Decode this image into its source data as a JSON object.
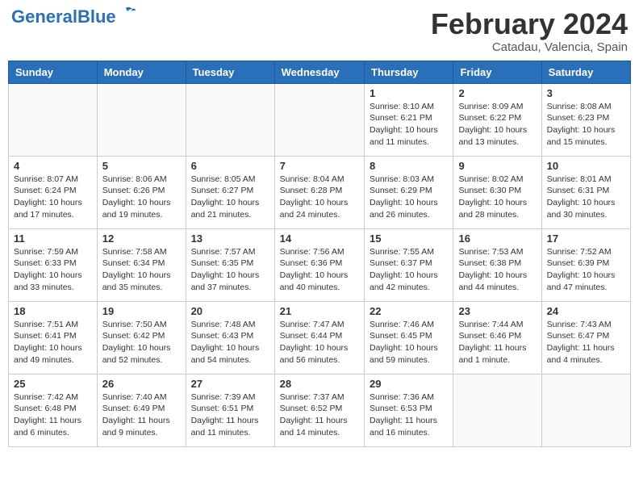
{
  "header": {
    "logo_general": "General",
    "logo_blue": "Blue",
    "month_title": "February 2024",
    "location": "Catadau, Valencia, Spain"
  },
  "days_of_week": [
    "Sunday",
    "Monday",
    "Tuesday",
    "Wednesday",
    "Thursday",
    "Friday",
    "Saturday"
  ],
  "weeks": [
    [
      {
        "day": "",
        "info": ""
      },
      {
        "day": "",
        "info": ""
      },
      {
        "day": "",
        "info": ""
      },
      {
        "day": "",
        "info": ""
      },
      {
        "day": "1",
        "info": "Sunrise: 8:10 AM\nSunset: 6:21 PM\nDaylight: 10 hours and 11 minutes."
      },
      {
        "day": "2",
        "info": "Sunrise: 8:09 AM\nSunset: 6:22 PM\nDaylight: 10 hours and 13 minutes."
      },
      {
        "day": "3",
        "info": "Sunrise: 8:08 AM\nSunset: 6:23 PM\nDaylight: 10 hours and 15 minutes."
      }
    ],
    [
      {
        "day": "4",
        "info": "Sunrise: 8:07 AM\nSunset: 6:24 PM\nDaylight: 10 hours and 17 minutes."
      },
      {
        "day": "5",
        "info": "Sunrise: 8:06 AM\nSunset: 6:26 PM\nDaylight: 10 hours and 19 minutes."
      },
      {
        "day": "6",
        "info": "Sunrise: 8:05 AM\nSunset: 6:27 PM\nDaylight: 10 hours and 21 minutes."
      },
      {
        "day": "7",
        "info": "Sunrise: 8:04 AM\nSunset: 6:28 PM\nDaylight: 10 hours and 24 minutes."
      },
      {
        "day": "8",
        "info": "Sunrise: 8:03 AM\nSunset: 6:29 PM\nDaylight: 10 hours and 26 minutes."
      },
      {
        "day": "9",
        "info": "Sunrise: 8:02 AM\nSunset: 6:30 PM\nDaylight: 10 hours and 28 minutes."
      },
      {
        "day": "10",
        "info": "Sunrise: 8:01 AM\nSunset: 6:31 PM\nDaylight: 10 hours and 30 minutes."
      }
    ],
    [
      {
        "day": "11",
        "info": "Sunrise: 7:59 AM\nSunset: 6:33 PM\nDaylight: 10 hours and 33 minutes."
      },
      {
        "day": "12",
        "info": "Sunrise: 7:58 AM\nSunset: 6:34 PM\nDaylight: 10 hours and 35 minutes."
      },
      {
        "day": "13",
        "info": "Sunrise: 7:57 AM\nSunset: 6:35 PM\nDaylight: 10 hours and 37 minutes."
      },
      {
        "day": "14",
        "info": "Sunrise: 7:56 AM\nSunset: 6:36 PM\nDaylight: 10 hours and 40 minutes."
      },
      {
        "day": "15",
        "info": "Sunrise: 7:55 AM\nSunset: 6:37 PM\nDaylight: 10 hours and 42 minutes."
      },
      {
        "day": "16",
        "info": "Sunrise: 7:53 AM\nSunset: 6:38 PM\nDaylight: 10 hours and 44 minutes."
      },
      {
        "day": "17",
        "info": "Sunrise: 7:52 AM\nSunset: 6:39 PM\nDaylight: 10 hours and 47 minutes."
      }
    ],
    [
      {
        "day": "18",
        "info": "Sunrise: 7:51 AM\nSunset: 6:41 PM\nDaylight: 10 hours and 49 minutes."
      },
      {
        "day": "19",
        "info": "Sunrise: 7:50 AM\nSunset: 6:42 PM\nDaylight: 10 hours and 52 minutes."
      },
      {
        "day": "20",
        "info": "Sunrise: 7:48 AM\nSunset: 6:43 PM\nDaylight: 10 hours and 54 minutes."
      },
      {
        "day": "21",
        "info": "Sunrise: 7:47 AM\nSunset: 6:44 PM\nDaylight: 10 hours and 56 minutes."
      },
      {
        "day": "22",
        "info": "Sunrise: 7:46 AM\nSunset: 6:45 PM\nDaylight: 10 hours and 59 minutes."
      },
      {
        "day": "23",
        "info": "Sunrise: 7:44 AM\nSunset: 6:46 PM\nDaylight: 11 hours and 1 minute."
      },
      {
        "day": "24",
        "info": "Sunrise: 7:43 AM\nSunset: 6:47 PM\nDaylight: 11 hours and 4 minutes."
      }
    ],
    [
      {
        "day": "25",
        "info": "Sunrise: 7:42 AM\nSunset: 6:48 PM\nDaylight: 11 hours and 6 minutes."
      },
      {
        "day": "26",
        "info": "Sunrise: 7:40 AM\nSunset: 6:49 PM\nDaylight: 11 hours and 9 minutes."
      },
      {
        "day": "27",
        "info": "Sunrise: 7:39 AM\nSunset: 6:51 PM\nDaylight: 11 hours and 11 minutes."
      },
      {
        "day": "28",
        "info": "Sunrise: 7:37 AM\nSunset: 6:52 PM\nDaylight: 11 hours and 14 minutes."
      },
      {
        "day": "29",
        "info": "Sunrise: 7:36 AM\nSunset: 6:53 PM\nDaylight: 11 hours and 16 minutes."
      },
      {
        "day": "",
        "info": ""
      },
      {
        "day": "",
        "info": ""
      }
    ]
  ]
}
